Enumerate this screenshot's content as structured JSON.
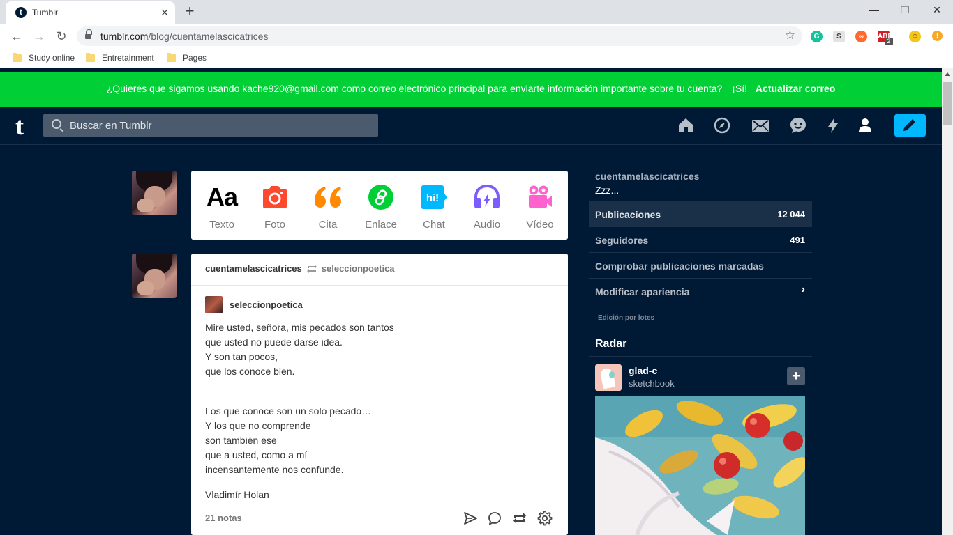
{
  "browser": {
    "tab_title": "Tumblr",
    "tab_favicon": "t",
    "url_domain": "tumblr.com",
    "url_path": "/blog/cuentamelascicatrices",
    "bookmarks": [
      "Study online",
      "Entretainment",
      "Pages"
    ],
    "extensions": [
      {
        "name": "grammarly-icon",
        "color": "#15c39a"
      },
      {
        "name": "s-extension-icon",
        "color": "#e3e3e3"
      },
      {
        "name": "infinity-icon",
        "color": "#ff6a30"
      },
      {
        "name": "adblock-icon",
        "color": "#d01f26",
        "badge": "2"
      },
      {
        "name": "emoji-icon",
        "color": "#f5c518"
      },
      {
        "name": "update-alert-icon",
        "color": "#f9a825"
      }
    ]
  },
  "banner": {
    "message": "¿Quieres que sigamos usando kache920@gmail.com como correo electrónico principal para enviarte información importante sobre tu cuenta?",
    "yes": "¡Sí!",
    "update": "Actualizar correo"
  },
  "header": {
    "logo": "t",
    "search_placeholder": "Buscar en Tumblr",
    "icons": [
      "home-icon",
      "explore-icon",
      "inbox-icon",
      "messages-icon",
      "activity-icon",
      "account-icon",
      "compose-icon"
    ]
  },
  "post_types": [
    {
      "label": "Texto",
      "icon": "text-icon",
      "color": "#000000"
    },
    {
      "label": "Foto",
      "icon": "photo-icon",
      "color": "#ff492f"
    },
    {
      "label": "Cita",
      "icon": "quote-icon",
      "color": "#ff8a00"
    },
    {
      "label": "Enlace",
      "icon": "link-icon",
      "color": "#00cf35"
    },
    {
      "label": "Chat",
      "icon": "chat-icon",
      "color": "#00b8ff"
    },
    {
      "label": "Audio",
      "icon": "audio-icon",
      "color": "#7c5cff"
    },
    {
      "label": "Vídeo",
      "icon": "video-icon",
      "color": "#ff62ce"
    }
  ],
  "post": {
    "author": "cuentamelascicatrices",
    "reblogged_from": "seleccionpoetica",
    "reblog_author": "seleccionpoetica",
    "stanza1": [
      "Mire usted, señora, mis pecados son tantos",
      "que usted no puede darse idea.",
      "Y son tan pocos,",
      "que los conoce bien."
    ],
    "stanza2": [
      "Los que conoce son un solo pecado…",
      "Y los que no comprende",
      "son también ese",
      "que a usted, como a mí",
      "incensantemente nos confunde."
    ],
    "signature": "Vladimír Holan",
    "notes": "21 notas"
  },
  "sidebar": {
    "blog_name": "cuentamelascicatrices",
    "description": "Zzz...",
    "rows": [
      {
        "label": "Publicaciones",
        "value": "12 044"
      },
      {
        "label": "Seguidores",
        "value": "491"
      },
      {
        "label": "Comprobar publicaciones marcadas",
        "value": ""
      },
      {
        "label": "Modificar apariencia",
        "value": ""
      }
    ],
    "batch_edit": "Edición por lotes",
    "radar": {
      "title": "Radar",
      "blog": "glad-c",
      "subtitle": "sketchbook",
      "follow": "+"
    }
  }
}
